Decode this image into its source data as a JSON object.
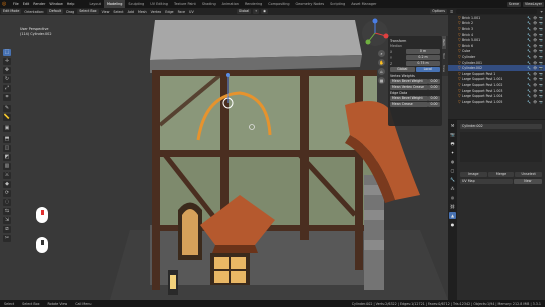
{
  "menubar": {
    "menus": [
      "File",
      "Edit",
      "Render",
      "Window",
      "Help"
    ],
    "workspaces": [
      "Layout",
      "Modeling",
      "Sculpting",
      "UV Editing",
      "Texture Paint",
      "Shading",
      "Animation",
      "Rendering",
      "Compositing",
      "Geometry Nodes",
      "Scripting",
      "Asset Manager"
    ],
    "active_workspace_index": 1,
    "scene_label": "Scene",
    "viewlayer_label": "ViewLayer"
  },
  "header": {
    "mode": "Edit Mode",
    "orientation": "Default",
    "drag": "Drag",
    "select_box": "Select Box",
    "menus": [
      "View",
      "Select",
      "Add",
      "Mesh",
      "Vertex",
      "Edge",
      "Face",
      "UV"
    ],
    "transform": "Global",
    "options": "Options"
  },
  "viewport": {
    "view_name": "User Perspective",
    "object_name": "(114) Cylinder.002",
    "tools": [
      "select",
      "cursor",
      "move",
      "rotate",
      "scale",
      "transform",
      "annotate",
      "measure",
      "add-cube",
      "extrude",
      "inset",
      "bevel",
      "loop-cut",
      "knife",
      "poly-build",
      "spin",
      "smooth",
      "edge-slide",
      "shrink",
      "shear",
      "rip"
    ]
  },
  "npanel": {
    "section": "Transform",
    "median_label": "Median",
    "fields": [
      {
        "label": "X",
        "value": "0 m"
      },
      {
        "label": "Y",
        "value": "0.2 m"
      },
      {
        "label": "Z",
        "value": "0.75 m"
      }
    ],
    "global_label": "Global",
    "local_label": "Local",
    "vertex_weights": "Vertex Weights",
    "bevel_weight": "Mean Bevel Weight",
    "bevel_weight_val": "0.00",
    "vertex_crease": "Mean Vertex Crease",
    "vertex_crease_val": "0.00",
    "edge_data": "Edge Data",
    "edge_bevel": "Mean Bevel Weight",
    "edge_bevel_val": "0.00",
    "edge_crease": "Mean Crease",
    "edge_crease_val": "0.00",
    "tabs": [
      "Item",
      "Tool",
      "View"
    ]
  },
  "outliner": {
    "items": [
      {
        "name": "Brick 1.001",
        "sel": false
      },
      {
        "name": "Brick 2",
        "sel": false
      },
      {
        "name": "Brick 3",
        "sel": false
      },
      {
        "name": "Brick 4",
        "sel": false
      },
      {
        "name": "Brick 5.001",
        "sel": false
      },
      {
        "name": "Brick 6",
        "sel": false
      },
      {
        "name": "Cube",
        "sel": false
      },
      {
        "name": "Cylinder",
        "sel": false
      },
      {
        "name": "Cylinder.001",
        "sel": false
      },
      {
        "name": "Cylinder.002",
        "sel": true
      },
      {
        "name": "Large Support Post 1",
        "sel": false
      },
      {
        "name": "Large Support Post 1.001",
        "sel": false
      },
      {
        "name": "Large Support Post 1.002",
        "sel": false
      },
      {
        "name": "Large Support Post 1.003",
        "sel": false
      },
      {
        "name": "Large Support Post 1.004",
        "sel": false
      },
      {
        "name": "Large Support Post 1.005",
        "sel": false
      }
    ]
  },
  "properties": {
    "object": "Cylinder.002",
    "columns": [
      "Image",
      "Merge",
      "Unselect"
    ],
    "uv_label": "UV Map",
    "new_label": "New"
  },
  "status": {
    "select": "Select",
    "box_select": "Select Box",
    "rotate": "Rotate View",
    "call_menu": "Call Menu",
    "stats": "Cylinder.002 | Verts:2/6322 | Edges:1/12721 | Faces:0/6712 | Tris:12342 | Objects:1/94 | Memory: 212.8 MiB | 3.3.1"
  },
  "colors": {
    "accent": "#4772b3",
    "orange": "#e87d0d",
    "wall": "#8a977a",
    "timber": "#4a2e20",
    "roof": "#b5592e"
  }
}
